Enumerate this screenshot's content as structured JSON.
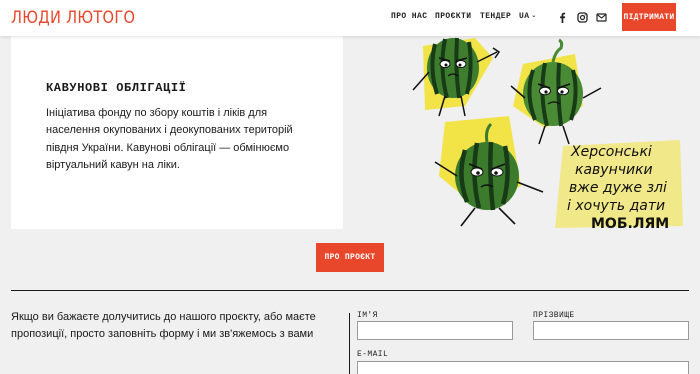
{
  "header": {
    "logo": "ЛЮДИ ЛЮТОГО",
    "nav": {
      "about": "ПРО НАС",
      "projects": "ПРОЄКТИ",
      "tender": "ТЕНДЕР",
      "lang": "UA"
    },
    "social_icons": [
      "facebook-icon",
      "instagram-icon",
      "mail-icon"
    ],
    "donate_label": "ПІДТРИМАТИ"
  },
  "project": {
    "title": "КАВУНОВІ ОБЛІГАЦІЇ",
    "description": "Ініціатива фонду по збору коштів і ліків для населення окупованих і деокупованих територій півдня України. Кавунові облігації — обмінюємо віртуальний кавун на ліки.",
    "image_caption": [
      "Херсонські",
      "кавунчики",
      "вже дуже злі",
      "і хочуть дати",
      "МОБ.ЛЯМ"
    ],
    "about_button": "ПРО ПРОЄКТ"
  },
  "contact": {
    "intro": "Якщо ви бажаєте долучитись до нашого проєкту, або маєте пропозиції, просто заповніть форму і ми зв'яжемось з вами",
    "fields": {
      "name_label": "ІМ'Я",
      "name_value": "",
      "surname_label": "ПРІЗВИЩЕ",
      "surname_value": "",
      "email_label": "E-MAIL",
      "email_value": ""
    }
  },
  "colors": {
    "accent": "#e8472b",
    "background": "#f0f0f0",
    "card": "#ffffff",
    "melon_dark": "#1f4a1e",
    "melon_light": "#6fae4a",
    "highlight": "#f2e234"
  }
}
